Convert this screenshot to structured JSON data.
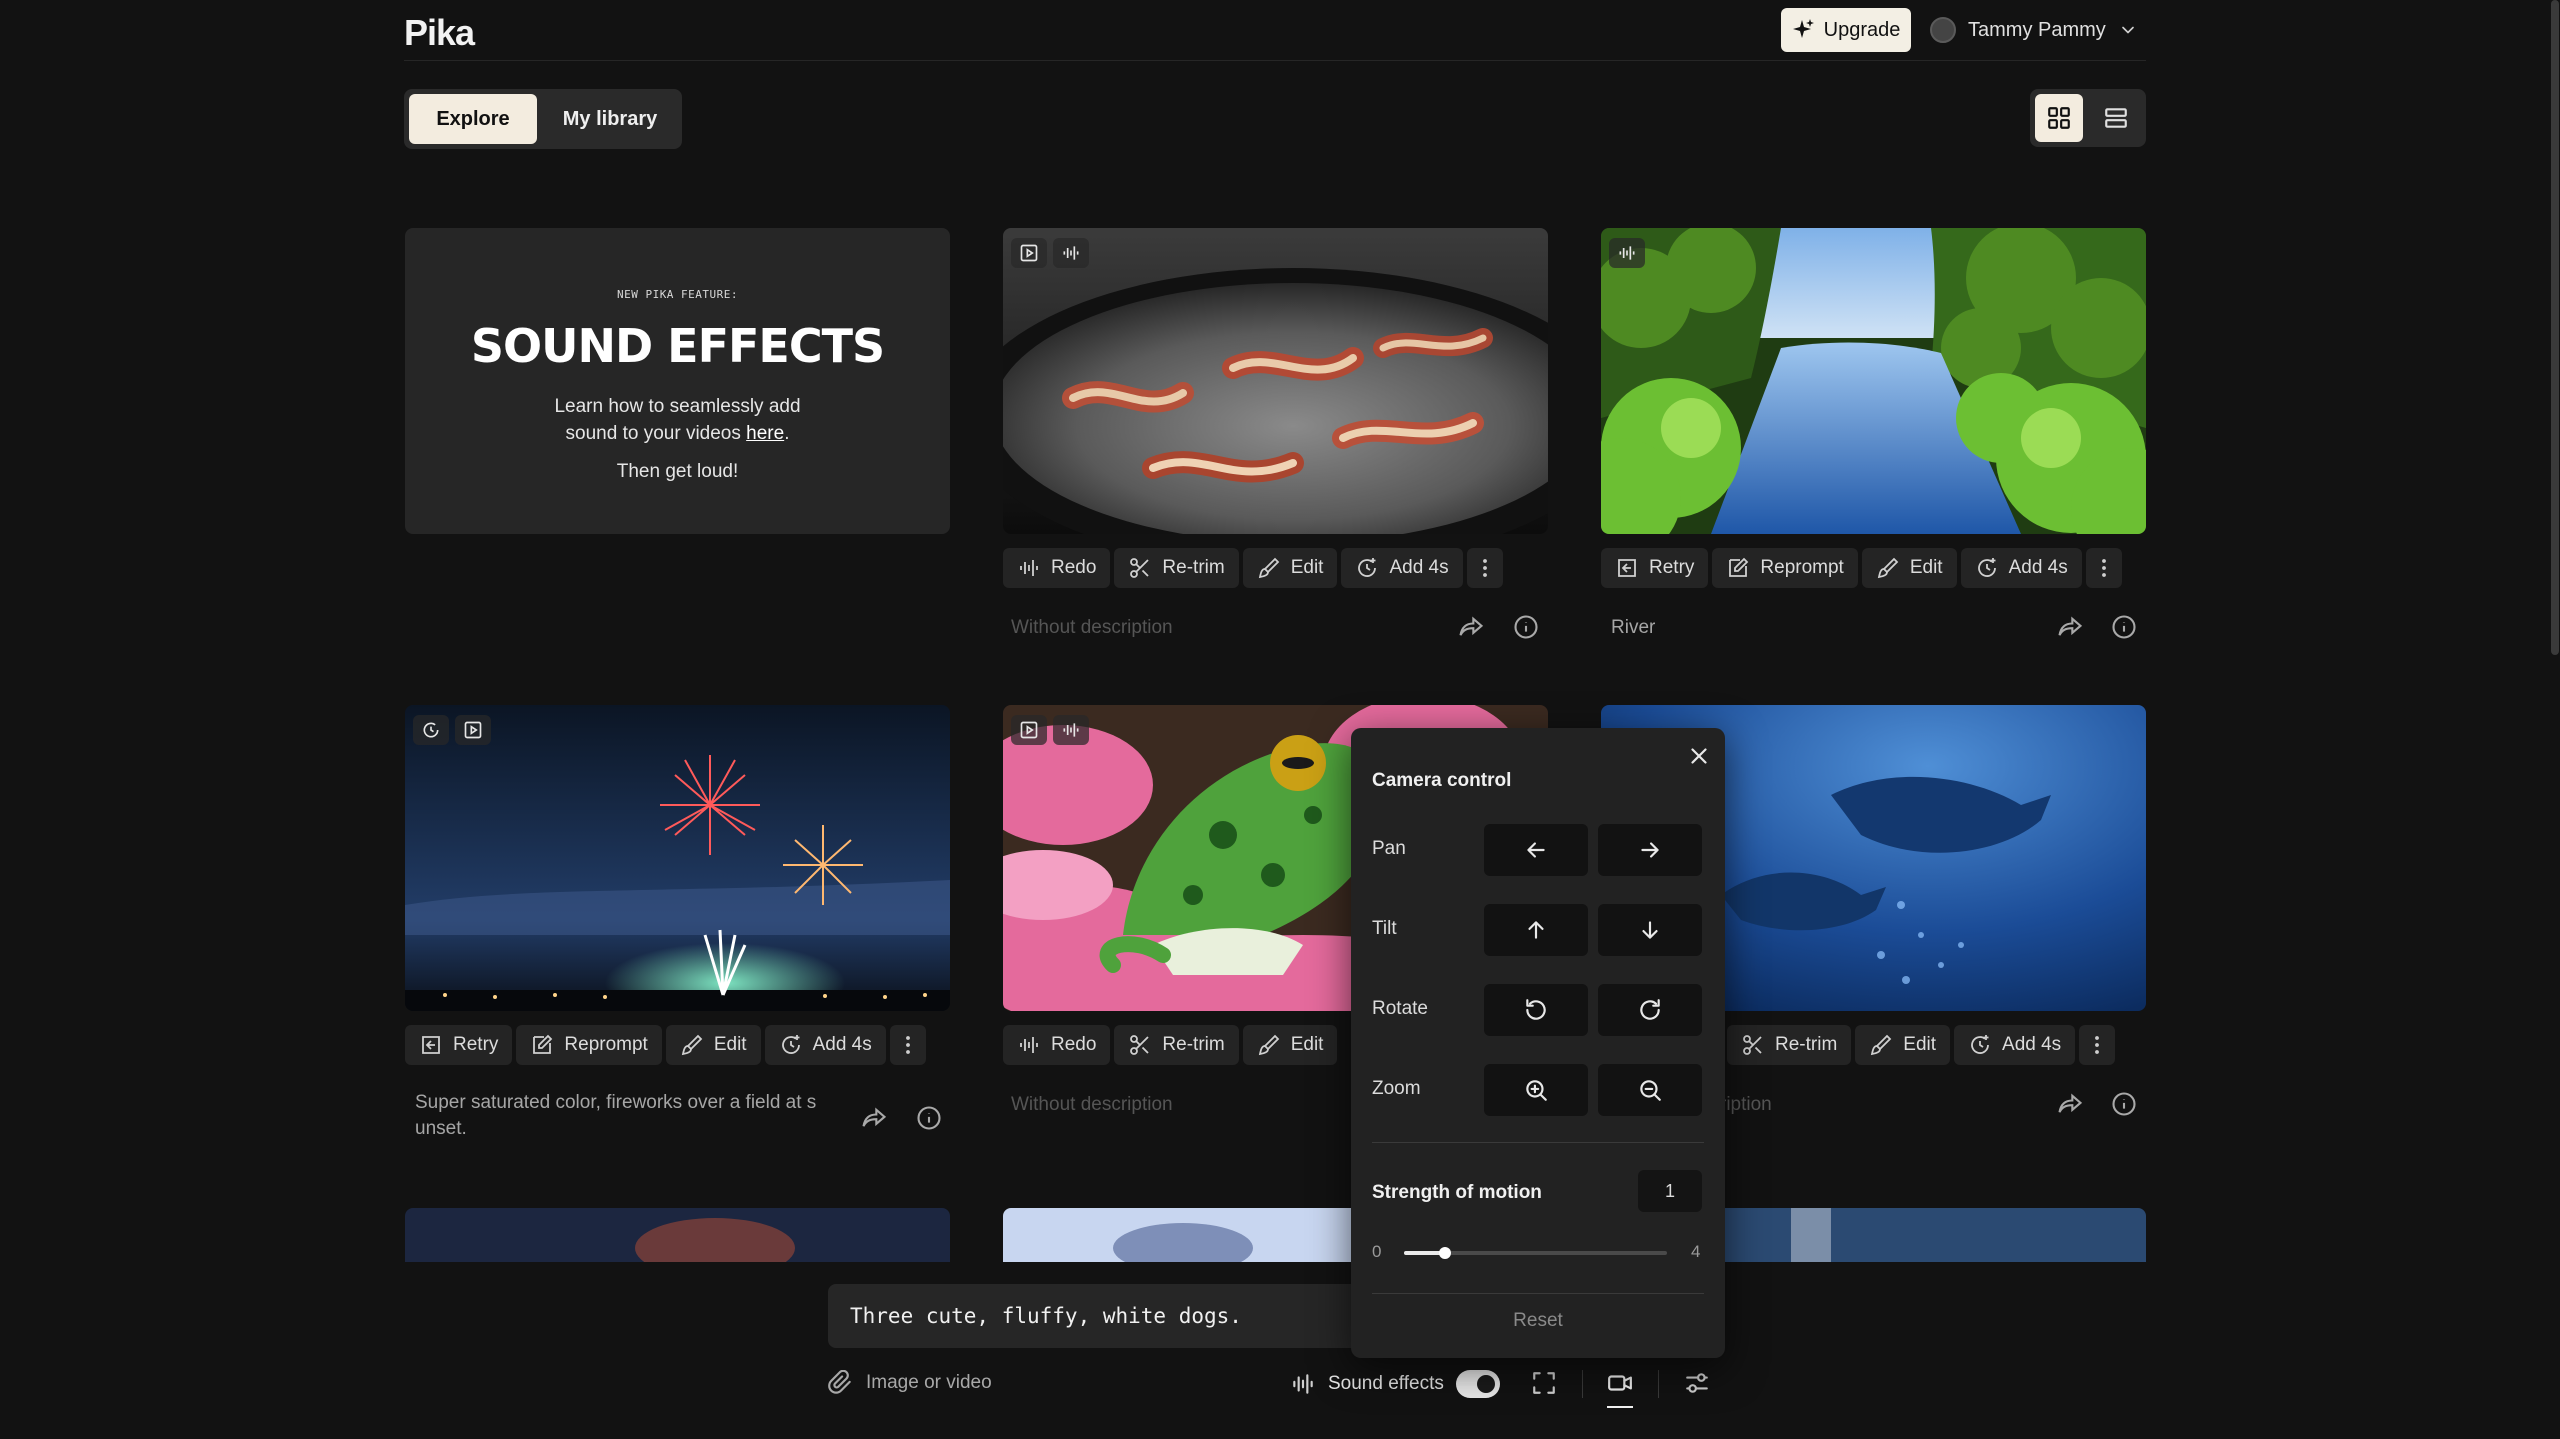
{
  "header": {
    "logo": "Pika",
    "upgrade": "Upgrade",
    "user": "Tammy Pammy"
  },
  "tabs": {
    "explore": "Explore",
    "library": "My library"
  },
  "promo": {
    "kicker": "NEW PIKA FEATURE:",
    "title": "SOUND EFFECTS",
    "line1": "Learn how to seamlessly add",
    "line2_pre": "sound to your videos ",
    "link": "here",
    "line2_post": ".",
    "line3": "Then get loud!"
  },
  "cards": {
    "bacon": {
      "actions": [
        "Redo",
        "Re-trim",
        "Edit",
        "Add 4s"
      ],
      "desc": "Without description"
    },
    "river": {
      "actions": [
        "Retry",
        "Reprompt",
        "Edit",
        "Add 4s"
      ],
      "desc": "River"
    },
    "fireworks": {
      "actions": [
        "Retry",
        "Reprompt",
        "Edit",
        "Add 4s"
      ],
      "desc": "Super saturated color, fireworks over a field at s unset."
    },
    "frog": {
      "actions": [
        "Redo",
        "Re-trim",
        "Edit"
      ],
      "desc": "Without description"
    },
    "dolphins": {
      "actions": [
        "Re-trim",
        "Edit",
        "Add 4s"
      ],
      "desc": "ription"
    }
  },
  "prompt": {
    "text": "Three cute, fluffy, white dogs.",
    "attach": "Image or video",
    "sound_effects": "Sound effects",
    "sound_effects_on": true
  },
  "camera": {
    "title": "Camera control",
    "rows": [
      "Pan",
      "Tilt",
      "Rotate",
      "Zoom"
    ],
    "strength_label": "Strength of motion",
    "strength_value": "1",
    "slider_min": "0",
    "slider_max": "4",
    "reset": "Reset"
  },
  "colors": {
    "accent": "#f3ecdf",
    "bg": "#121212",
    "panel": "#222222"
  }
}
